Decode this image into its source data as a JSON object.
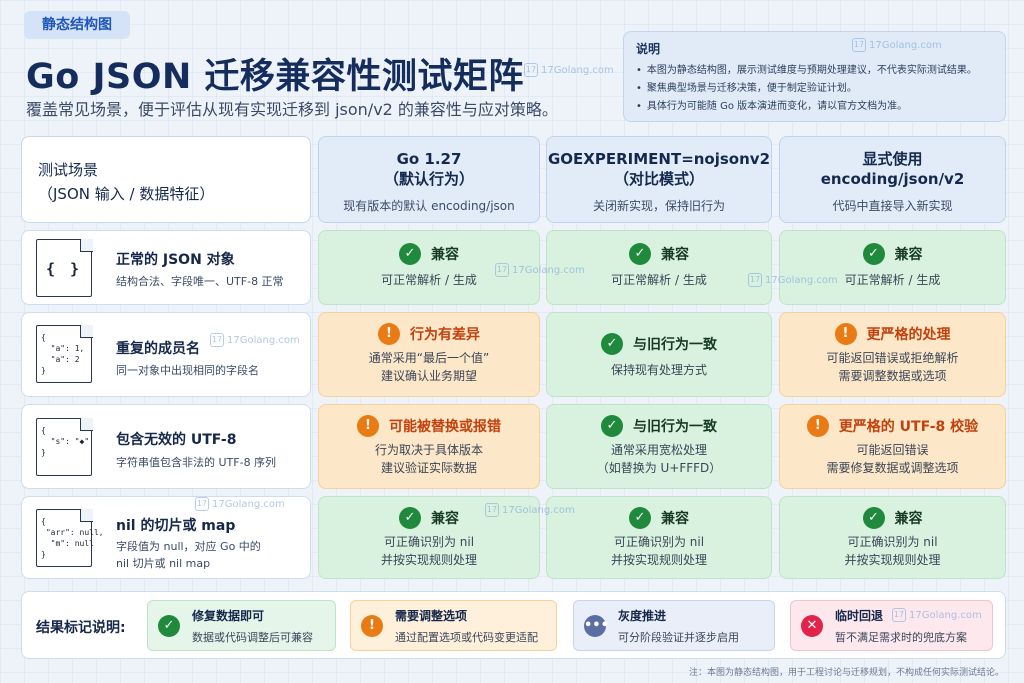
{
  "tag": "静态结构图",
  "title": "Go JSON 迁移兼容性测试矩阵",
  "subtitle": "覆盖常见场景，便于评估从现有实现迁移到 json/v2 的兼容性与应对策略。",
  "watermark": "17Golang.com",
  "notes": {
    "title": "说明",
    "items": [
      "本图为静态结构图，展示测试维度与预期处理建议，不代表实际测试结果。",
      "聚焦典型场景与迁移决策，便于制定验证计划。",
      "具体行为可能随 Go 版本演进而变化，请以官方文档为准。"
    ]
  },
  "columns": [
    {
      "title_1": "测试场景",
      "title_2": "（JSON 输入 / 数据特征）",
      "sub": ""
    },
    {
      "title_1": "Go 1.27",
      "title_2": "（默认行为）",
      "sub": "现有版本的默认 encoding/json"
    },
    {
      "title_1": "GOEXPERIMENT=nojsonv2",
      "title_2": "（对比模式）",
      "sub": "关闭新实现，保持旧行为"
    },
    {
      "title_1": "显式使用",
      "title_2": "encoding/json/v2",
      "sub": "代码中直接导入新实现"
    }
  ],
  "rows": [
    {
      "title": "正常的 JSON 对象",
      "desc_1": "结构合法、字段唯一、UTF-8 正常",
      "desc_2": "",
      "icon_text": "{ }",
      "cells": [
        {
          "label": "兼容",
          "line_1": "可正常解析 / 生成",
          "line_2": ""
        },
        {
          "label": "兼容",
          "line_1": "可正常解析 / 生成",
          "line_2": ""
        },
        {
          "label": "兼容",
          "line_1": "可正常解析 / 生成",
          "line_2": ""
        }
      ]
    },
    {
      "title": "重复的成员名",
      "desc_1": "同一对象中出现相同的字段名",
      "desc_2": "",
      "icon_text": "{\n  \"a\": 1,\n  \"a\": 2\n}",
      "cells": [
        {
          "label": "行为有差异",
          "line_1": "通常采用“最后一个值”",
          "line_2": "建议确认业务期望"
        },
        {
          "label": "与旧行为一致",
          "line_1": "保持现有处理方式",
          "line_2": ""
        },
        {
          "label": "更严格的处理",
          "line_1": "可能返回错误或拒绝解析",
          "line_2": "需要调整数据或选项"
        }
      ]
    },
    {
      "title": "包含无效的 UTF-8",
      "desc_1": "字符串值包含非法的 UTF-8 序列",
      "desc_2": "",
      "icon_text": "{\n  \"s\": \"◆\"\n}",
      "cells": [
        {
          "label": "可能被替换或报错",
          "line_1": "行为取决于具体版本",
          "line_2": "建议验证实际数据"
        },
        {
          "label": "与旧行为一致",
          "line_1": "通常采用宽松处理",
          "line_2": "（如替换为 U+FFFD）"
        },
        {
          "label": "更严格的 UTF-8 校验",
          "line_1": "可能返回错误",
          "line_2": "需要修复数据或调整选项"
        }
      ]
    },
    {
      "title": "nil 的切片或 map",
      "desc_1": "字段值为 null，对应 Go 中的",
      "desc_2": "nil 切片或 nil map",
      "icon_text": "{\n \"arr\": null,\n  \"m\": null\n}",
      "cells": [
        {
          "label": "兼容",
          "line_1": "可正确识别为 nil",
          "line_2": "并按实现规则处理"
        },
        {
          "label": "兼容",
          "line_1": "可正确识别为 nil",
          "line_2": "并按实现规则处理"
        },
        {
          "label": "兼容",
          "line_1": "可正确识别为 nil",
          "line_2": "并按实现规则处理"
        }
      ]
    }
  ],
  "legend": {
    "title": "结果标记说明:",
    "items": [
      {
        "title": "修复数据即可",
        "desc": "数据或代码调整后可兼容",
        "icon": "check-icon"
      },
      {
        "title": "需要调整选项",
        "desc": "通过配置选项或代码变更适配",
        "icon": "warning-icon"
      },
      {
        "title": "灰度推进",
        "desc": "可分阶段验证并逐步启用",
        "icon": "ellipsis-icon"
      },
      {
        "title": "临时回退",
        "desc": "暂不满足需求时的兜底方案",
        "icon": "cross-icon"
      }
    ]
  },
  "footnote": "注：本图为静态结构图，用于工程讨论与迁移规划，不构成任何实际测试结论。",
  "colors": {
    "ok_bg": "#d9f2df",
    "ok_icon": "#1f8a3c",
    "warn_bg": "#fde7c9",
    "warn_icon": "#ea7b14",
    "warn_text": "#c2410c",
    "gray_icon": "#5b6ea3",
    "red_icon": "#e0244a",
    "title": "#152d5c"
  }
}
